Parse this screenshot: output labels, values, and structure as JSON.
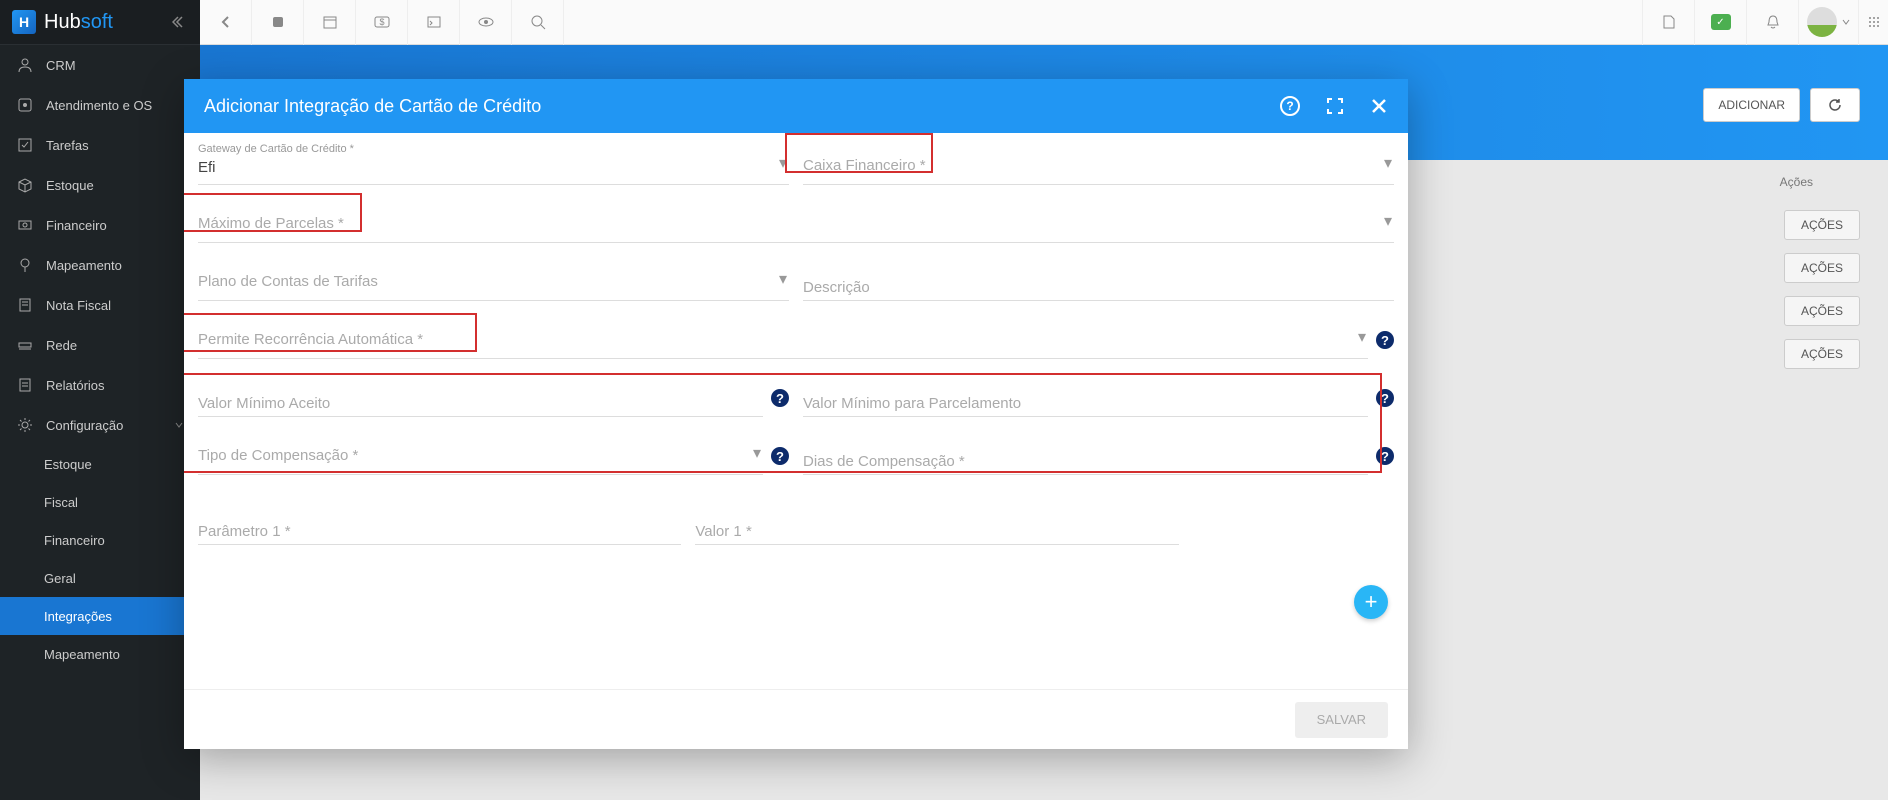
{
  "sidebar": {
    "items": [
      {
        "label": "CRM"
      },
      {
        "label": "Atendimento e OS"
      },
      {
        "label": "Tarefas"
      },
      {
        "label": "Estoque"
      },
      {
        "label": "Financeiro"
      },
      {
        "label": "Mapeamento"
      },
      {
        "label": "Nota Fiscal"
      },
      {
        "label": "Rede"
      },
      {
        "label": "Relatórios"
      },
      {
        "label": "Configuração"
      }
    ],
    "subitems": [
      {
        "label": "Estoque"
      },
      {
        "label": "Fiscal"
      },
      {
        "label": "Financeiro"
      },
      {
        "label": "Geral"
      },
      {
        "label": "Integrações"
      },
      {
        "label": "Mapeamento"
      }
    ]
  },
  "page": {
    "add_button": "ADICIONAR",
    "actions_header": "Ações",
    "action_button": "AÇÕES"
  },
  "modal": {
    "title": "Adicionar Integração de Cartão de Crédito",
    "save": "SALVAR",
    "fields": {
      "gateway_label": "Gateway de Cartão de Crédito *",
      "gateway_value": "Efi",
      "caixa": "Caixa Financeiro *",
      "max_parcelas": "Máximo de Parcelas *",
      "plano_contas": "Plano de Contas de Tarifas",
      "descricao": "Descrição",
      "recorrencia": "Permite Recorrência Automática *",
      "valor_min": "Valor Mínimo Aceito",
      "valor_min_parc": "Valor Mínimo para Parcelamento",
      "tipo_comp": "Tipo de Compensação *",
      "dias_comp": "Dias de Compensação *",
      "param1": "Parâmetro 1 *",
      "valor1": "Valor 1 *"
    }
  }
}
